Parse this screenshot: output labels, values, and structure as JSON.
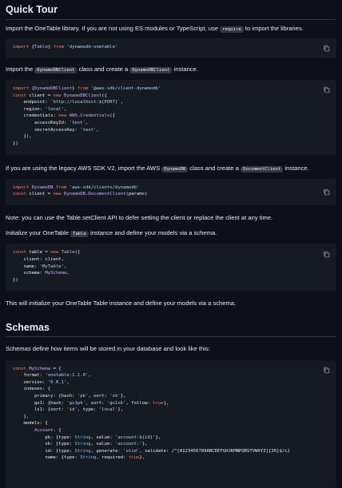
{
  "quick_tour": {
    "heading": "Quick Tour",
    "p1": {
      "before": "Import the OneTable library. If you are not using ES modules or TypeScript, use ",
      "code": "require",
      "after": " to import the libraries."
    },
    "p2": {
      "before": "Import the ",
      "code": "DynamoDBClient",
      "after": " class and create a ",
      "code2": "DynamoDBClient",
      "after2": " instance."
    },
    "p3": {
      "before": "If you are using the legacy AWS SDK V2, import the AWS ",
      "code": "DynamoDB",
      "after": " class and create a ",
      "code2": "DocumentClient",
      "after2": " instance."
    },
    "p4": "Note: you can use the Table.setClient API to defer setting the client or replace the client at any time.",
    "p5": {
      "before": "Initialize your OneTable ",
      "code": "Table",
      "after": " instance and define your models via a schema."
    },
    "p6": "This will initialize your OneTable Table instance and define your models via a schema."
  },
  "schemas": {
    "heading": "Schemas",
    "p1": "Schemas define how items will be stored in your database and look like this:"
  },
  "code_blocks": {
    "import_table": "import {Table} from 'dynamodb-onetable'",
    "dynamo_client": "import {DynamoDBClient} from '@aws-sdk/client-dynamodb'\nconst client = new DynamoDBClient({\n    endpoint: `http://localhost:${PORT}`,\n    region: 'local',\n    credentials: new AWS.Credentials({\n        accessKeyId: 'test',\n        secretAccessKey: 'test',\n    }),\n})",
    "legacy_sdk": "import DynamoDB from 'aws-sdk/clients/dynamodb'\nconst client = new DynamoDB.DocumentClient(params)",
    "table_init": "const table = new Table({\n    client: client,\n    name: 'MyTable',\n    schema: MySchema,\n})",
    "schema": "const MySchema = {\n    format: 'onetable:1.1.0',\n    version: '0.0.1',\n    indexes: {\n        primary: {hash: 'pk', sort: 'sk'},\n        gs1: {hash: 'gs1pk', sort: 'gs1sk', follow: true},\n        ls1: {sort: 'id', type: 'local'},\n    },\n    models: {\n        Account: {\n            pk: {type: String, value: 'account:${id}'},\n            sk: {type: String, value: 'account:'},\n            id: {type: String, generate: 'ulid', validate: /^[0123456789ABCDEFGHJKMNPQRSTVWXYZ]{26}$/i}\n            name: {type: String, required: true},"
  },
  "icons": {
    "copy": "copy-icon"
  },
  "colors": {
    "background": "#0d1117",
    "code_background": "#161b22",
    "keyword": "#ff7b72",
    "string": "#a5d6ff",
    "function": "#d2a8ff",
    "constant": "#79c0ff"
  }
}
